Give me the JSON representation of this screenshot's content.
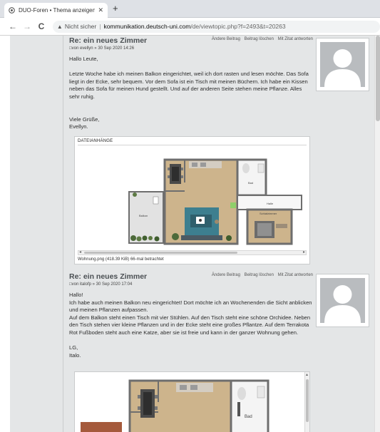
{
  "browser": {
    "tab_title": "DUO-Foren • Thema anzeigen - …",
    "tab_close": "✕",
    "new_tab": "+",
    "back": "←",
    "forward": "→",
    "reload": "C",
    "security_icon": "▲",
    "security_label": "Nicht sicher",
    "url_sep": "|",
    "url_host": "kommunikation.deutsch-uni.com",
    "url_path": "/de/viewtopic.php?f=2493&t=20263"
  },
  "posts": [
    {
      "title": "Re: ein neues Zimmer",
      "actions": [
        "Ändere Beitrag",
        "Beitrag löschen",
        "Mit Zitat antworten"
      ],
      "meta": "□von evellyn » 30 Sep 2020 14:26",
      "body": [
        "Hallo Leute,",
        "",
        "Letzte Woche habe ich meinen Balkon eingerichtet, weil ich dort rasten und lesen möchte. Das Sofa liegt in der Ecke, sehr bequem. Vor dem Sofa ist ein Tisch mit meinen Büchern. Ich habe ein Kissen neben das Sofa für meinen Hund gestellt. Und auf der anderen Seite stehen meine Pflanze. Alles sehr ruhig.",
        "",
        "",
        "Viele Grüße,",
        "Evellyn."
      ],
      "attachment": {
        "heading": "DATEIANHÄNGE",
        "caption": "Wohnung.png (418.39 KiB) 66-mal betrachtet",
        "room_labels": [
          "Bad",
          "Halle",
          "Schlafzimmer",
          "Balkon"
        ]
      }
    },
    {
      "title": "Re: ein neues Zimmer",
      "actions": [
        "Ändere Beitrag",
        "Beitrag löschen",
        "Mit Zitat antworten"
      ],
      "meta": "□von italofp » 30 Sep 2020 17:04",
      "body": [
        "Hallo!",
        "Ich habe auch meinen Balkon neu eingerichtet! Dort möchte ich an Wochenenden die Sicht anblicken und meinen Pflanzen aufpassen.",
        "Auf dem Balkon steht einen Tisch mit vier Stühlen. Auf den Tisch steht eine schöne Orchidee. Neben den Tisch stehen vier kleine Pflanzen und in der Ecke steht eine großes Pflantze. Auf dem Terrakota Rot Fußboden steht auch eine Katze, aber sie ist freie und kann in der ganzer Wohnung gehen.",
        "",
        "LG,",
        "Italo."
      ],
      "attachment": {
        "room_labels": [
          "Bad"
        ]
      }
    }
  ],
  "colors": {
    "forum_bg": "#e4e6e7",
    "floor_wood": "#cdb48c",
    "wall": "#6e6e6e",
    "accent_blue": "#3a7a8c"
  }
}
